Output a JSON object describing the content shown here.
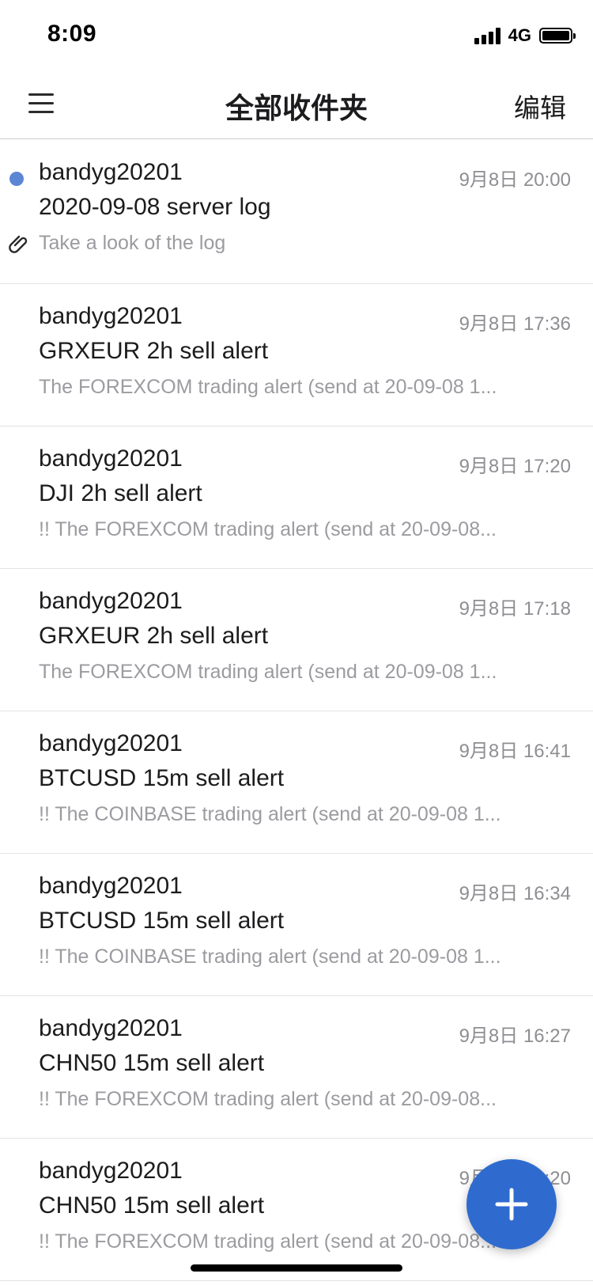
{
  "status_bar": {
    "time": "8:09",
    "network": "4G",
    "battery_level": 1.0
  },
  "nav": {
    "title": "全部收件夹",
    "edit_label": "编辑",
    "menu_icon": "hamburger-menu-icon"
  },
  "mails": [
    {
      "sender": "bandyg20201",
      "time": "9月8日 20:00",
      "subject": "2020-09-08 server log",
      "preview": "Take a look of the log",
      "unread": true,
      "has_attachment": true
    },
    {
      "sender": "bandyg20201",
      "time": "9月8日 17:36",
      "subject": "GRXEUR 2h sell alert",
      "preview": "The FOREXCOM trading alert (send at 20-09-08 1...",
      "unread": false,
      "has_attachment": false
    },
    {
      "sender": "bandyg20201",
      "time": "9月8日 17:20",
      "subject": "DJI 2h sell alert",
      "preview": "!! The FOREXCOM trading alert (send at 20-09-08...",
      "unread": false,
      "has_attachment": false
    },
    {
      "sender": "bandyg20201",
      "time": "9月8日 17:18",
      "subject": "GRXEUR 2h sell alert",
      "preview": "The FOREXCOM trading alert (send at 20-09-08 1...",
      "unread": false,
      "has_attachment": false
    },
    {
      "sender": "bandyg20201",
      "time": "9月8日 16:41",
      "subject": "BTCUSD 15m sell alert",
      "preview": "!! The COINBASE trading alert (send at 20-09-08 1...",
      "unread": false,
      "has_attachment": false
    },
    {
      "sender": "bandyg20201",
      "time": "9月8日 16:34",
      "subject": "BTCUSD 15m sell alert",
      "preview": "!! The COINBASE trading alert (send at 20-09-08 1...",
      "unread": false,
      "has_attachment": false
    },
    {
      "sender": "bandyg20201",
      "time": "9月8日 16:27",
      "subject": "CHN50 15m sell alert",
      "preview": "!! The FOREXCOM trading alert (send at 20-09-08...",
      "unread": false,
      "has_attachment": false
    },
    {
      "sender": "bandyg20201",
      "time": "9月8日 16:20",
      "subject": "CHN50 15m sell alert",
      "preview": "!! The FOREXCOM trading alert (send at 20-09-08...",
      "unread": false,
      "has_attachment": false
    }
  ],
  "compose": {
    "icon": "plus-icon",
    "color": "#2f6bcf"
  },
  "colors": {
    "unread_dot": "#5b86d6",
    "preview_text": "#9b9ba0",
    "time_text": "#8e8e93"
  }
}
